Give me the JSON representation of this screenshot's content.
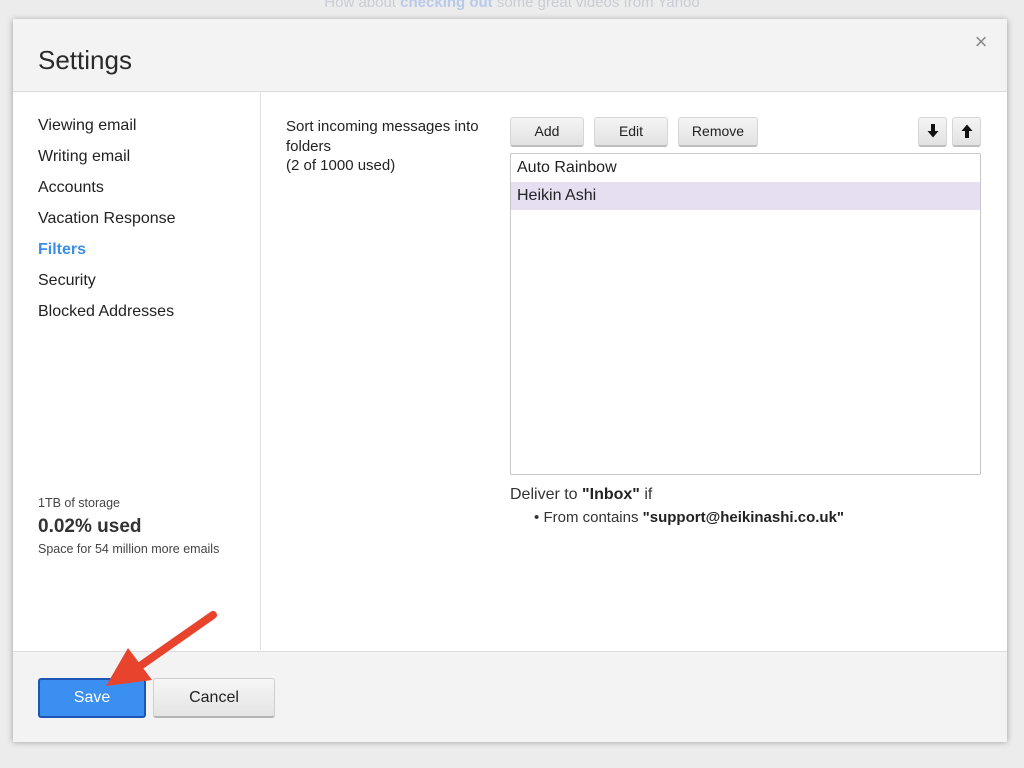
{
  "backdrop": {
    "before": "How about ",
    "link": "checking out",
    "after": " some great videos from Yahoo"
  },
  "dialog": {
    "title": "Settings",
    "close_glyph": "×"
  },
  "sidebar": {
    "items": [
      {
        "label": "Viewing email"
      },
      {
        "label": "Writing email"
      },
      {
        "label": "Accounts"
      },
      {
        "label": "Vacation Response"
      },
      {
        "label": "Filters",
        "active": true
      },
      {
        "label": "Security"
      },
      {
        "label": "Blocked Addresses"
      }
    ],
    "storage": {
      "capacity": "1TB of storage",
      "used": "0.02% used",
      "space": "Space for 54 million more emails"
    }
  },
  "filters": {
    "description_line1": "Sort incoming messages into folders",
    "description_line2": "(2 of 1000 used)",
    "buttons": {
      "add": "Add",
      "edit": "Edit",
      "remove": "Remove"
    },
    "move_down_icon": "arrow-down-icon",
    "move_up_icon": "arrow-up-icon",
    "list": [
      {
        "name": "Auto Rainbow",
        "selected": false
      },
      {
        "name": "Heikin Ashi",
        "selected": true
      }
    ],
    "deliver": {
      "prefix": "Deliver to ",
      "folder": "\"Inbox\"",
      "suffix": " if"
    },
    "condition": {
      "bullet": "•",
      "prefix": "From contains ",
      "value": "\"support@heikinashi.co.uk\""
    }
  },
  "footer": {
    "save_label": "Save",
    "cancel_label": "Cancel"
  },
  "colors": {
    "accent": "#3c8ee8",
    "save_button": "#3b8ff0",
    "selected_row": "#e6def1",
    "annotation_arrow": "#e8432d"
  }
}
